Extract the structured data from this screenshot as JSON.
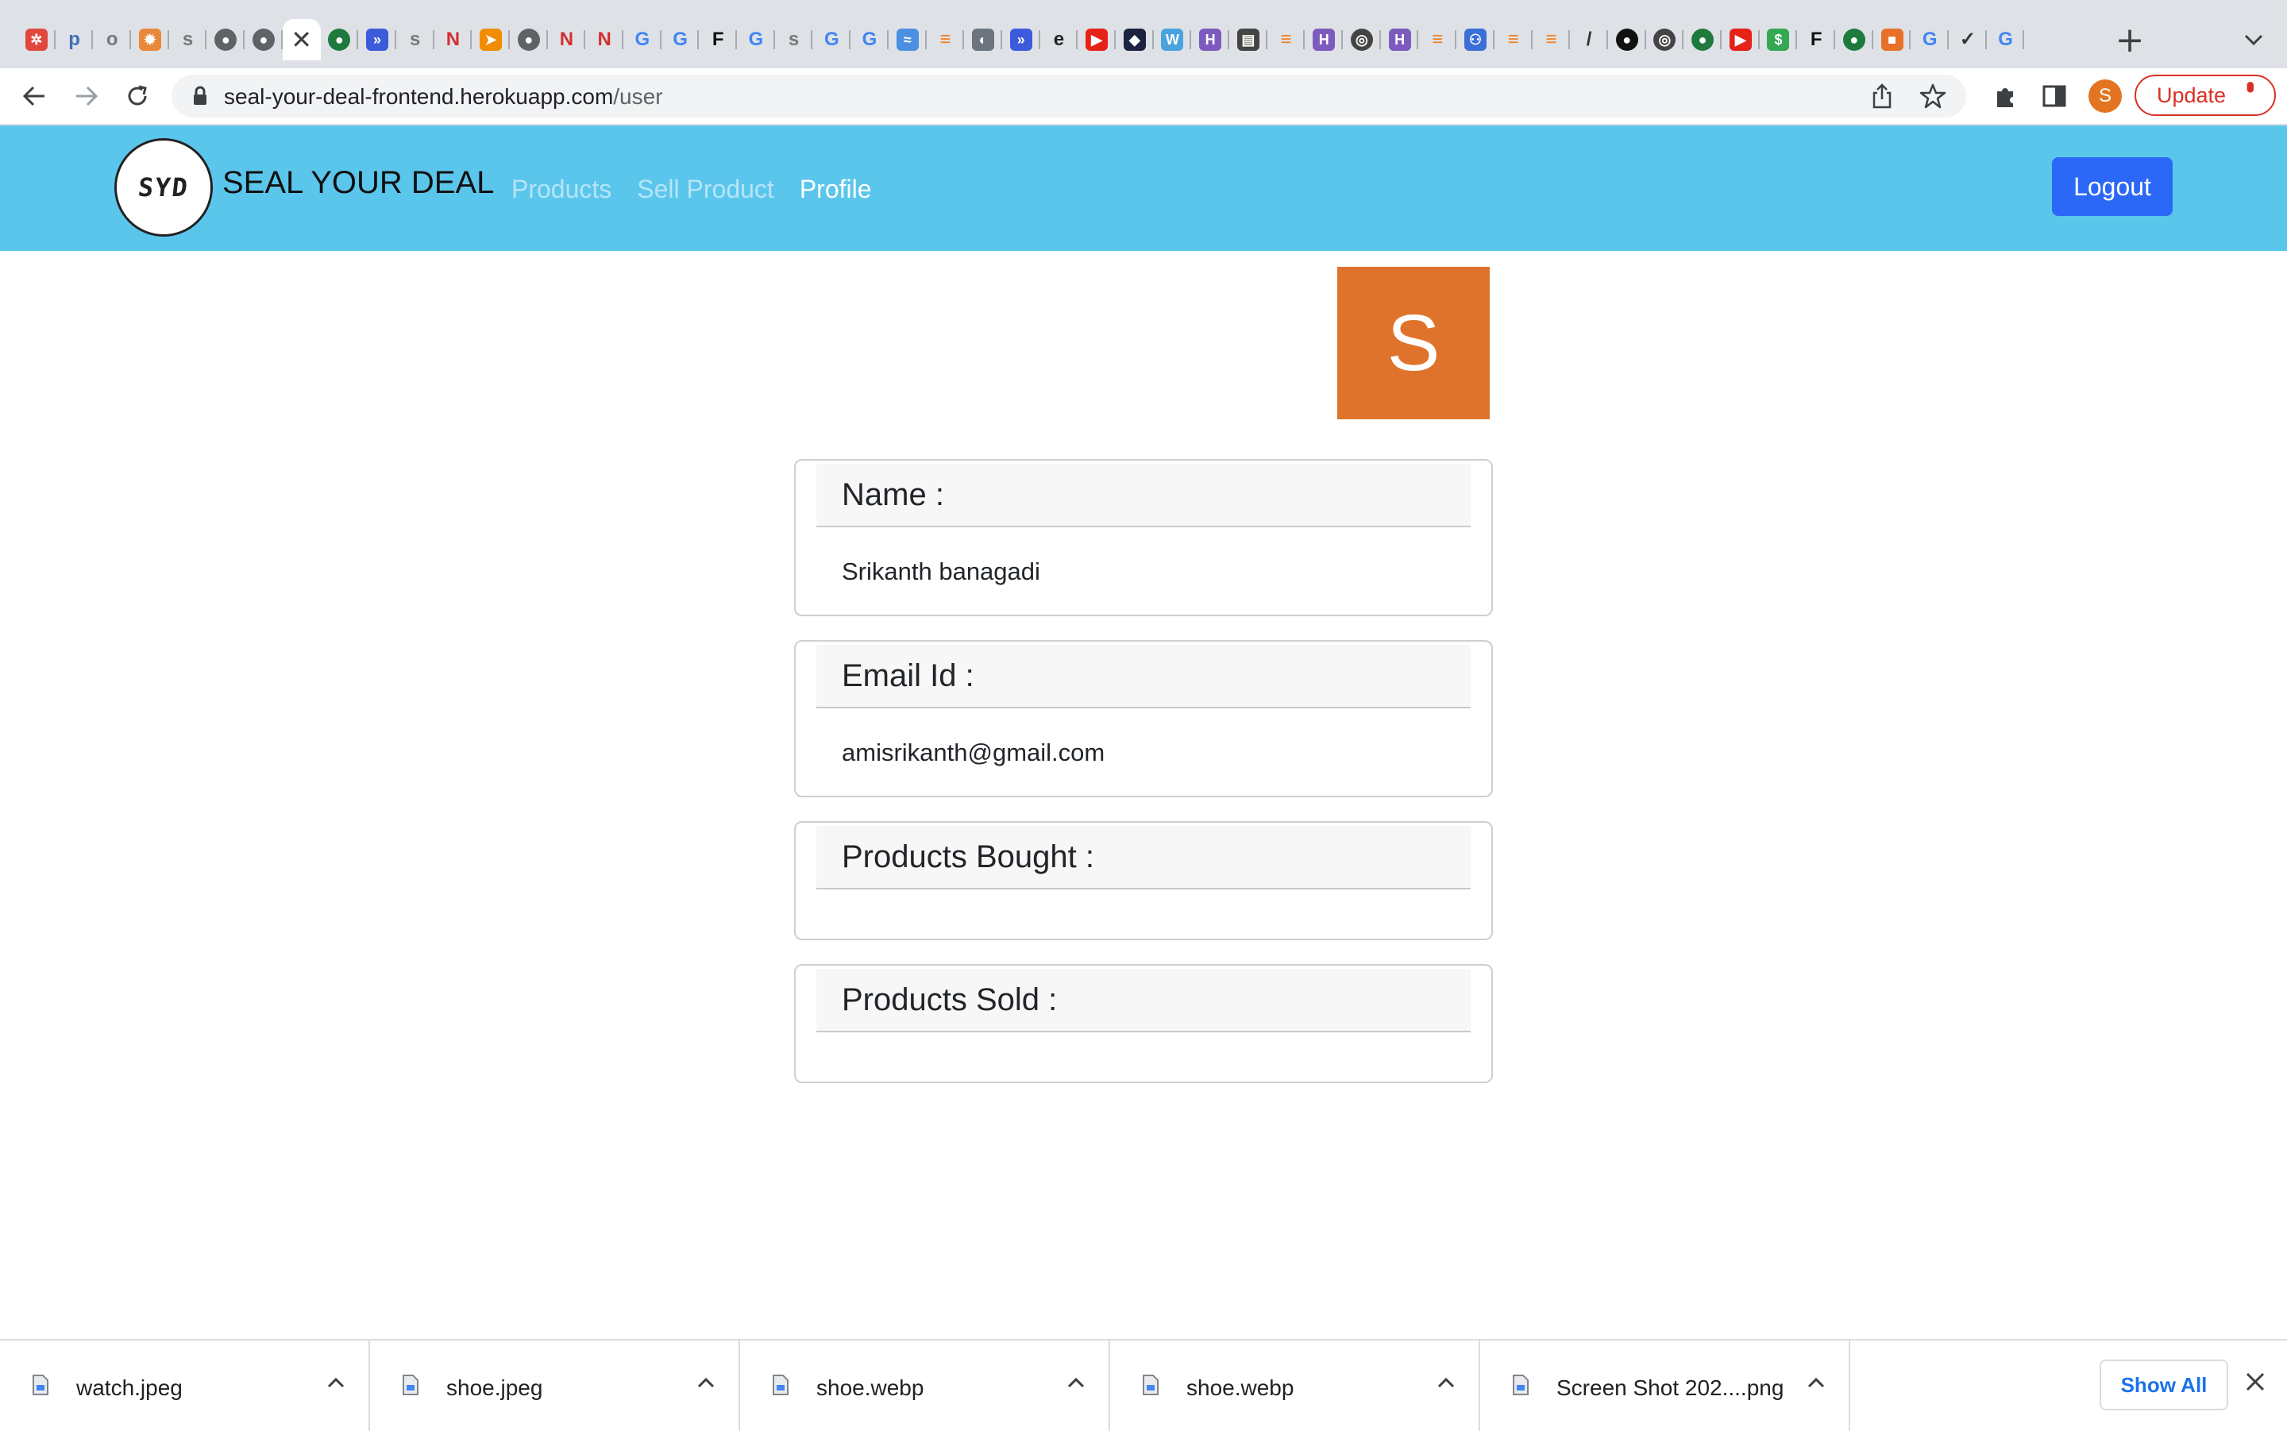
{
  "browser": {
    "tabs": [
      {
        "icon": "red-gear-icon",
        "color": "#e0483e",
        "glyph": "✲"
      },
      {
        "icon": "p-icon",
        "color": "#3f6fb6",
        "glyph": "p"
      },
      {
        "icon": "otc-icon",
        "color": "#6c7a89",
        "glyph": "o"
      },
      {
        "icon": "orange-badge-icon",
        "color": "#e8883a",
        "glyph": "✹"
      },
      {
        "icon": "syd-icon",
        "color": "#777777",
        "glyph": "s"
      },
      {
        "icon": "globe-icon",
        "color": "#5f6368",
        "glyph": "●"
      },
      {
        "icon": "globe-icon",
        "color": "#5f6368",
        "glyph": "●"
      },
      {
        "icon": "active-tab-close-icon",
        "color": "#3c4043",
        "glyph": "✕",
        "active": true
      },
      {
        "icon": "mongodb-leaf-icon",
        "color": "#1e7a3d",
        "glyph": "●"
      },
      {
        "icon": "double-chevron-icon",
        "color": "#3b5bdb",
        "glyph": "»"
      },
      {
        "icon": "syd-icon",
        "color": "#777777",
        "glyph": "s"
      },
      {
        "icon": "n-icon",
        "color": "#d32f2f",
        "glyph": "N"
      },
      {
        "icon": "arrow-icon",
        "color": "#f08c00",
        "glyph": "➤"
      },
      {
        "icon": "globe-icon",
        "color": "#5f6368",
        "glyph": "●"
      },
      {
        "icon": "n-icon",
        "color": "#d32f2f",
        "glyph": "N"
      },
      {
        "icon": "n-icon",
        "color": "#d32f2f",
        "glyph": "N"
      },
      {
        "icon": "google-icon",
        "color": "#4285f4",
        "glyph": "G"
      },
      {
        "icon": "google-icon",
        "color": "#4285f4",
        "glyph": "G"
      },
      {
        "icon": "f-icon",
        "color": "#111111",
        "glyph": "F"
      },
      {
        "icon": "google-icon",
        "color": "#4285f4",
        "glyph": "G"
      },
      {
        "icon": "syd-icon",
        "color": "#777777",
        "glyph": "s"
      },
      {
        "icon": "google-icon",
        "color": "#4285f4",
        "glyph": "G"
      },
      {
        "icon": "google-icon",
        "color": "#4285f4",
        "glyph": "G"
      },
      {
        "icon": "wave-icon",
        "color": "#4a90e2",
        "glyph": "≈"
      },
      {
        "icon": "stack-overflow-icon",
        "color": "#f48024",
        "glyph": "≡"
      },
      {
        "icon": "megaphone-icon",
        "color": "#6c757d",
        "glyph": "◐"
      },
      {
        "icon": "double-chevron-icon",
        "color": "#3b5bdb",
        "glyph": "»"
      },
      {
        "icon": "ex-icon",
        "color": "#222222",
        "glyph": "e"
      },
      {
        "icon": "youtube-icon",
        "color": "#e62117",
        "glyph": "▶"
      },
      {
        "icon": "dark-square-icon",
        "color": "#1c2340",
        "glyph": "◆"
      },
      {
        "icon": "w-icon",
        "color": "#4aa3df",
        "glyph": "W"
      },
      {
        "icon": "h-icon",
        "color": "#7d5bbe",
        "glyph": "H"
      },
      {
        "icon": "document-icon",
        "color": "#444444",
        "glyph": "▤"
      },
      {
        "icon": "stack-overflow-icon",
        "color": "#f48024",
        "glyph": "≡"
      },
      {
        "icon": "h-icon",
        "color": "#7d5bbe",
        "glyph": "H"
      },
      {
        "icon": "chrome-icon",
        "color": "#444444",
        "glyph": "◎"
      },
      {
        "icon": "h-icon",
        "color": "#7d5bbe",
        "glyph": "H"
      },
      {
        "icon": "stack-overflow-icon",
        "color": "#f48024",
        "glyph": "≡"
      },
      {
        "icon": "people-icon",
        "color": "#3b6fd8",
        "glyph": "⚇"
      },
      {
        "icon": "stack-overflow-icon",
        "color": "#f48024",
        "glyph": "≡"
      },
      {
        "icon": "stack-overflow-icon",
        "color": "#f48024",
        "glyph": "≡"
      },
      {
        "icon": "slash-icon",
        "color": "#333333",
        "glyph": "/"
      },
      {
        "icon": "github-icon",
        "color": "#111111",
        "glyph": "●"
      },
      {
        "icon": "chrome-icon",
        "color": "#444444",
        "glyph": "◎"
      },
      {
        "icon": "mongodb-leaf-icon",
        "color": "#1e7a3d",
        "glyph": "●"
      },
      {
        "icon": "youtube-icon",
        "color": "#e62117",
        "glyph": "▶"
      },
      {
        "icon": "green-dollar-icon",
        "color": "#34a853",
        "glyph": "$"
      },
      {
        "icon": "ff-icon",
        "color": "#111111",
        "glyph": "F"
      },
      {
        "icon": "mongodb-leaf-icon",
        "color": "#1e7a3d",
        "glyph": "●"
      },
      {
        "icon": "orange-cube-icon",
        "color": "#e8712a",
        "glyph": "■"
      },
      {
        "icon": "google-icon",
        "color": "#4285f4",
        "glyph": "G"
      },
      {
        "icon": "nike-swoosh-icon",
        "color": "#333333",
        "glyph": "✓"
      },
      {
        "icon": "google-icon",
        "color": "#4285f4",
        "glyph": "G"
      }
    ],
    "address": {
      "host": "seal-your-deal-frontend.herokuapp.com",
      "path": "/user"
    },
    "profile_initial": "S",
    "update_label": "Update",
    "colors": {
      "accent": "#d93025",
      "avatar": "#e37521"
    }
  },
  "app": {
    "logo_text": "SYD",
    "brand": "SEAL YOUR DEAL",
    "nav": [
      {
        "label": "Products",
        "active": false
      },
      {
        "label": "Sell Product",
        "active": false
      },
      {
        "label": "Profile",
        "active": true
      }
    ],
    "logout_label": "Logout",
    "colors": {
      "navbar": "#5bc6ec",
      "button": "#2c68f7",
      "avatar": "#e0732b"
    }
  },
  "profile": {
    "avatar_initial": "S",
    "name_label": "Name :",
    "name_value": "Srikanth banagadi",
    "email_label": "Email Id :",
    "email_value": "amisrikanth@gmail.com",
    "bought_label": "Products Bought :",
    "sold_label": "Products Sold :"
  },
  "downloads": {
    "items": [
      "watch.jpeg",
      "shoe.jpeg",
      "shoe.webp",
      "shoe.webp",
      "Screen Shot 202....png"
    ],
    "show_all_label": "Show All"
  }
}
